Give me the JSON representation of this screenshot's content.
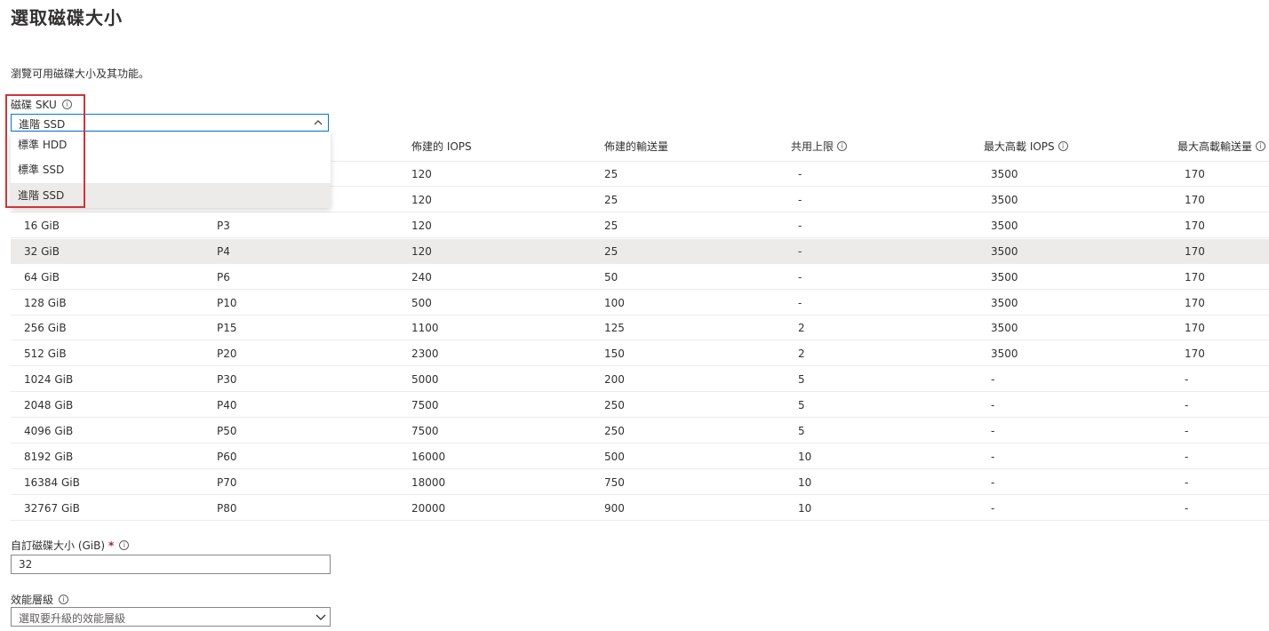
{
  "page": {
    "title": "選取磁碟大小",
    "description": "瀏覽可用磁碟大小及其功能。"
  },
  "sku": {
    "label": "磁碟 SKU",
    "selected": "進階 SSD",
    "options": [
      "標準 HDD",
      "標準 SSD",
      "進階 SSD"
    ]
  },
  "table": {
    "headers": [
      "佈建的 IOPS",
      "佈建的輸送量",
      "共用上限",
      "最大高載 IOPS",
      "最大高載輸送量"
    ],
    "rows": [
      [
        "",
        "",
        "120",
        "25",
        "-",
        "3500",
        "170"
      ],
      [
        "",
        "",
        "120",
        "25",
        "-",
        "3500",
        "170"
      ],
      [
        "16 GiB",
        "P3",
        "120",
        "25",
        "-",
        "3500",
        "170"
      ],
      [
        "32 GiB",
        "P4",
        "120",
        "25",
        "-",
        "3500",
        "170"
      ],
      [
        "64 GiB",
        "P6",
        "240",
        "50",
        "-",
        "3500",
        "170"
      ],
      [
        "128 GiB",
        "P10",
        "500",
        "100",
        "-",
        "3500",
        "170"
      ],
      [
        "256 GiB",
        "P15",
        "1100",
        "125",
        "2",
        "3500",
        "170"
      ],
      [
        "512 GiB",
        "P20",
        "2300",
        "150",
        "2",
        "3500",
        "170"
      ],
      [
        "1024 GiB",
        "P30",
        "5000",
        "200",
        "5",
        "-",
        "-"
      ],
      [
        "2048 GiB",
        "P40",
        "7500",
        "250",
        "5",
        "-",
        "-"
      ],
      [
        "4096 GiB",
        "P50",
        "7500",
        "250",
        "5",
        "-",
        "-"
      ],
      [
        "8192 GiB",
        "P60",
        "16000",
        "500",
        "10",
        "-",
        "-"
      ],
      [
        "16384 GiB",
        "P70",
        "18000",
        "750",
        "10",
        "-",
        "-"
      ],
      [
        "32767 GiB",
        "P80",
        "20000",
        "900",
        "10",
        "-",
        "-"
      ]
    ]
  },
  "custom_size": {
    "label": "自訂磁碟大小 (GiB)",
    "required_mark": "*",
    "value": "32"
  },
  "perf_tier": {
    "label": "效能層級",
    "placeholder": "選取要升級的效能層級"
  },
  "icons": {
    "info": "info-icon",
    "chevron_up": "chevron-up-icon",
    "chevron_down": "chevron-down-icon"
  },
  "colors": {
    "focus_border": "#0078d4",
    "highlight_box": "#d13438",
    "selected_row": "#edebe9",
    "required": "#a4262c"
  }
}
